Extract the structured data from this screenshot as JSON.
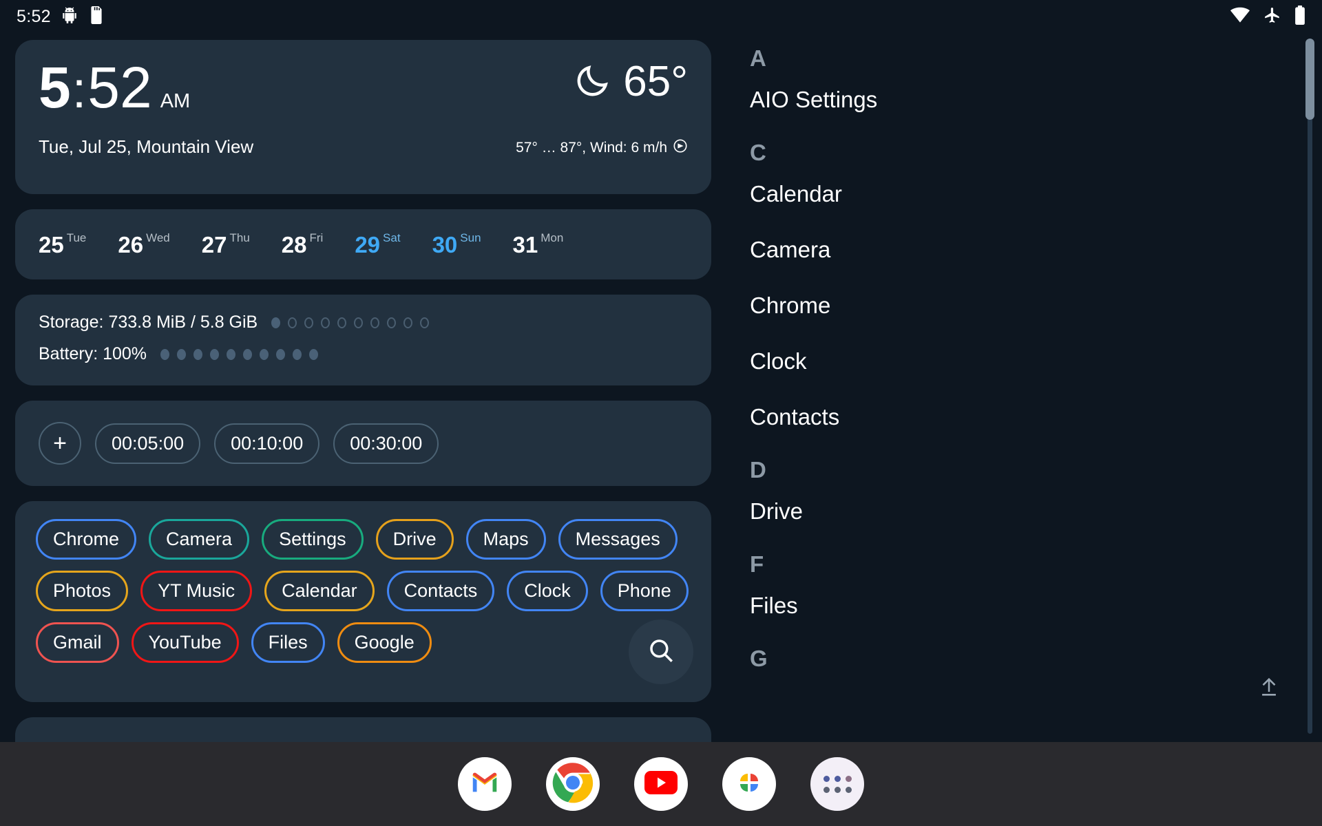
{
  "status_bar": {
    "time": "5:52",
    "left_icons": [
      "android-head-icon",
      "sd-card-icon"
    ],
    "right_icons": [
      "wifi-icon",
      "airplane-mode-icon",
      "battery-icon"
    ]
  },
  "clock_widget": {
    "hour": "5",
    "colon": ":",
    "minute": "52",
    "ampm": "AM",
    "date_location": "Tue, Jul 25, Mountain View",
    "weather_icon": "crescent-moon-icon",
    "temperature": "65°",
    "forecast": "57° … 87°, Wind: 6 m/h",
    "wind_icon": "wind-direction-icon"
  },
  "date_strip": [
    {
      "num": "25",
      "name": "Tue",
      "weekend": false
    },
    {
      "num": "26",
      "name": "Wed",
      "weekend": false
    },
    {
      "num": "27",
      "name": "Thu",
      "weekend": false
    },
    {
      "num": "28",
      "name": "Fri",
      "weekend": false
    },
    {
      "num": "29",
      "name": "Sat",
      "weekend": true
    },
    {
      "num": "30",
      "name": "Sun",
      "weekend": true
    },
    {
      "num": "31",
      "name": "Mon",
      "weekend": false
    }
  ],
  "meters": {
    "storage_label": "Storage: 733.8 MiB / 5.8 GiB",
    "storage_filled": 1,
    "storage_total": 10,
    "battery_label": "Battery: 100%",
    "battery_filled": 10,
    "battery_total": 10
  },
  "timers": {
    "add_label": "+",
    "presets": [
      "00:05:00",
      "00:10:00",
      "00:30:00"
    ]
  },
  "app_chips": {
    "rows": [
      [
        {
          "label": "Chrome",
          "color": "#4285f4"
        },
        {
          "label": "Camera",
          "color": "#1aa79b"
        },
        {
          "label": "Settings",
          "color": "#18ab7e"
        },
        {
          "label": "Drive",
          "color": "#e5a11c"
        },
        {
          "label": "Maps",
          "color": "#4285f4"
        },
        {
          "label": "Messages",
          "color": "#4285f4"
        }
      ],
      [
        {
          "label": "Photos",
          "color": "#e5a51c"
        },
        {
          "label": "YT Music",
          "color": "#f01616"
        },
        {
          "label": "Calendar",
          "color": "#e5a51c"
        },
        {
          "label": "Contacts",
          "color": "#4285f4"
        },
        {
          "label": "Clock",
          "color": "#4285f4"
        },
        {
          "label": "Phone",
          "color": "#4285f4"
        }
      ],
      [
        {
          "label": "Gmail",
          "color": "#ef5350"
        },
        {
          "label": "YouTube",
          "color": "#f01616"
        },
        {
          "label": "Files",
          "color": "#4285f4"
        },
        {
          "label": "Google",
          "color": "#ef8c11"
        }
      ]
    ],
    "search_icon": "search-icon"
  },
  "app_drawer": {
    "entries": [
      {
        "type": "section",
        "label": "A"
      },
      {
        "type": "app",
        "label": "AIO Settings"
      },
      {
        "type": "section",
        "label": "C"
      },
      {
        "type": "app",
        "label": "Calendar"
      },
      {
        "type": "app",
        "label": "Camera"
      },
      {
        "type": "app",
        "label": "Chrome"
      },
      {
        "type": "app",
        "label": "Clock"
      },
      {
        "type": "app",
        "label": "Contacts"
      },
      {
        "type": "section",
        "label": "D"
      },
      {
        "type": "app",
        "label": "Drive"
      },
      {
        "type": "section",
        "label": "F"
      },
      {
        "type": "app",
        "label": "Files"
      },
      {
        "type": "section",
        "label": "G"
      }
    ],
    "scroll_top_icon": "scroll-to-top-icon"
  },
  "dock": {
    "apps": [
      {
        "name": "Gmail",
        "icon": "gmail-icon"
      },
      {
        "name": "Chrome",
        "icon": "chrome-icon"
      },
      {
        "name": "YouTube",
        "icon": "youtube-icon"
      },
      {
        "name": "Photos",
        "icon": "google-photos-icon"
      },
      {
        "name": "All apps",
        "icon": "app-drawer-grid-icon"
      }
    ]
  },
  "colors": {
    "background": "#0d1620",
    "card": "#22313f",
    "dock": "#2a2a2e",
    "accent_blue": "#3fa9f5",
    "muted": "#8d9aa6"
  }
}
